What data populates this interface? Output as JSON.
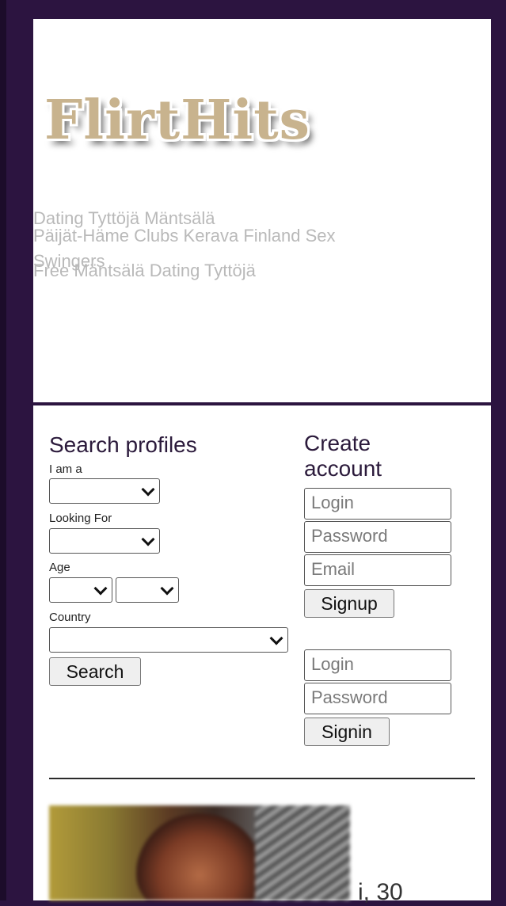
{
  "header": {
    "logo_text": "FlirtHits",
    "seo_lines": [
      "Dating Tyttöjä Mäntsälä",
      "Päijät-Häme Clubs Kerava Finland Sex",
      "Swingers",
      "Free Mäntsälä Dating Tyttöjä"
    ]
  },
  "search": {
    "title": "Search profiles",
    "i_am_label": "I am a",
    "looking_for_label": "Looking For",
    "age_label": "Age",
    "country_label": "Country",
    "search_button": "Search"
  },
  "account": {
    "create_title": "Create account",
    "login_placeholder": "Login",
    "password_placeholder": "Password",
    "email_placeholder": "Email",
    "signup_button": "Signup",
    "signin_login_placeholder": "Login",
    "signin_password_placeholder": "Password",
    "signin_button": "Signin"
  },
  "profile": {
    "meta_text": "i, 30"
  },
  "colors": {
    "background": "#2c1440",
    "panel": "#ffffff",
    "logo": "#c8b38e"
  }
}
